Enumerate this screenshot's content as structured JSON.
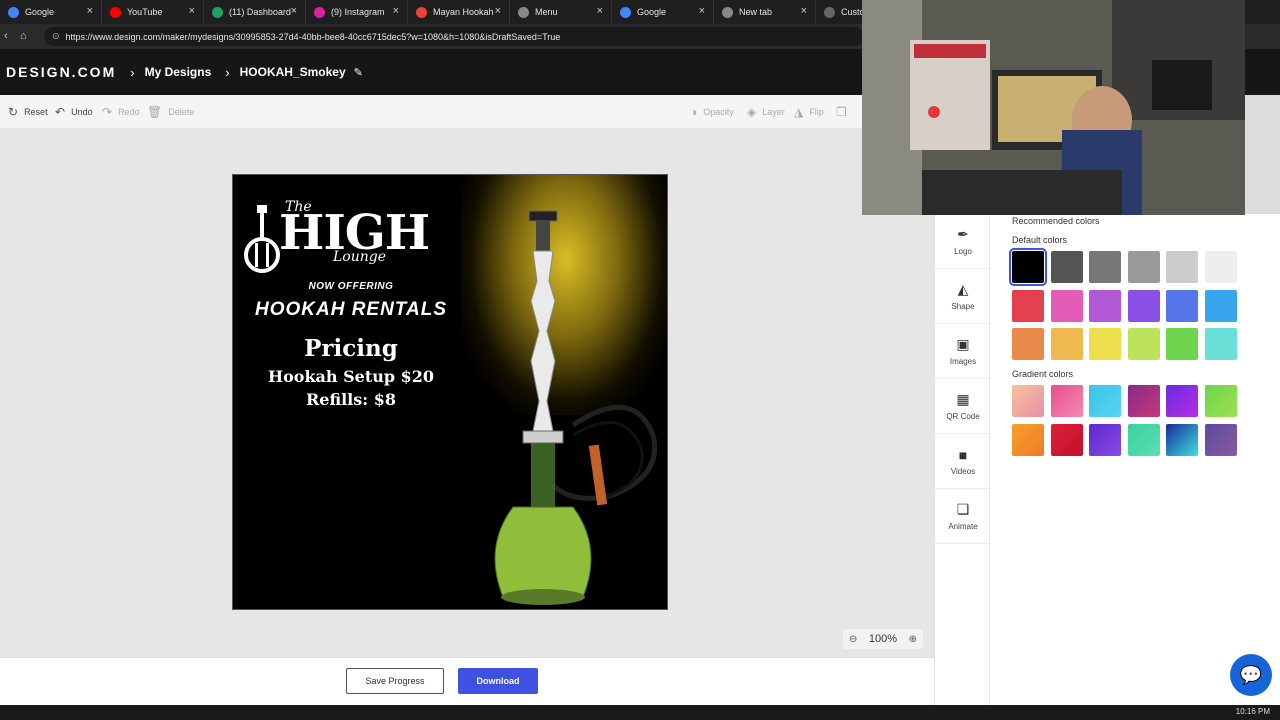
{
  "browser": {
    "tabs": [
      {
        "label": "Google",
        "icon": "google-icon",
        "color": "#4285f4"
      },
      {
        "label": "YouTube",
        "icon": "youtube-icon",
        "color": "#ff0000"
      },
      {
        "label": "(11) Dashboard",
        "icon": "dashboard-icon",
        "color": "#1aa260"
      },
      {
        "label": "(9) Instagram",
        "icon": "instagram-icon",
        "color": "#d6249f"
      },
      {
        "label": "Mayan Hookah",
        "icon": "map-pin-icon",
        "color": "#ea4335"
      },
      {
        "label": "Menu",
        "icon": "globe-icon",
        "color": "#888888"
      },
      {
        "label": "Google",
        "icon": "google-icon",
        "color": "#4285f4"
      },
      {
        "label": "New tab",
        "icon": "newtab-icon",
        "color": "#888888"
      },
      {
        "label": "Custo",
        "icon": "design-icon",
        "color": "#666666"
      }
    ],
    "url": "https://www.design.com/maker/mydesigns/30995853-27d4-40bb-bee8-40cc6715dec5?w=1080&h=1080&isDraftSaved=True"
  },
  "header": {
    "logo": "DESIGN.COM",
    "crumb1": "My Designs",
    "crumb2": "HOOKAH_Smokey"
  },
  "toolbar": {
    "reset": "Reset",
    "undo": "Undo",
    "redo": "Redo",
    "delete": "Delete",
    "opacity": "Opacity",
    "layer": "Layer",
    "flip": "Flip"
  },
  "design": {
    "brand_the": "The",
    "brand_high": "HIGH",
    "brand_lounge": "Lounge",
    "now_offering": "NOW OFFERING",
    "rentals": "HOOKAH RENTALS",
    "pricing": "Pricing",
    "setup": "Hookah Setup $20",
    "refills": "Refills: $8"
  },
  "zoom": {
    "value": "100%"
  },
  "bottom": {
    "save": "Save Progress",
    "download": "Download"
  },
  "tools": [
    {
      "label": "Logo",
      "icon": "logo-icon"
    },
    {
      "label": "Shape",
      "icon": "shape-icon"
    },
    {
      "label": "Images",
      "icon": "image-icon"
    },
    {
      "label": "QR Code",
      "icon": "qr-code-icon"
    },
    {
      "label": "Videos",
      "icon": "video-icon"
    },
    {
      "label": "Animate",
      "icon": "animate-icon"
    }
  ],
  "colors": {
    "recommended_title": "Recommended colors",
    "default_title": "Default colors",
    "gradient_title": "Gradient colors",
    "default": [
      "#000000",
      "#555555",
      "#777777",
      "#999999",
      "#cccccc",
      "#eeeeee",
      "#e5404e",
      "#e55bb8",
      "#b25ad6",
      "#8a4fe6",
      "#5476e8",
      "#38a6ec",
      "#ea8a4a",
      "#efb94d",
      "#eee04c",
      "#bde35a",
      "#6cd54d",
      "#6ae0d8"
    ],
    "gradient": [
      [
        "#f6c39a",
        "#e890a8"
      ],
      [
        "#e94f8f",
        "#f08ab0"
      ],
      [
        "#39c3ea",
        "#58d5f0"
      ],
      [
        "#8a2a8a",
        "#c23a78"
      ],
      [
        "#6a2be5",
        "#b82ce0"
      ],
      [
        "#6cd54d",
        "#a0e050"
      ],
      [
        "#f5a02a",
        "#f07a2a"
      ],
      [
        "#e0203a",
        "#c0102a"
      ],
      [
        "#5a2ad0",
        "#8a4ae0"
      ],
      [
        "#3ad0a0",
        "#5ae0b0"
      ],
      [
        "#1a2a9a",
        "#3ae0e0"
      ],
      [
        "#5a4aa0",
        "#8a5aa0"
      ]
    ]
  },
  "taskbar": {
    "clock": "10:16 PM"
  }
}
